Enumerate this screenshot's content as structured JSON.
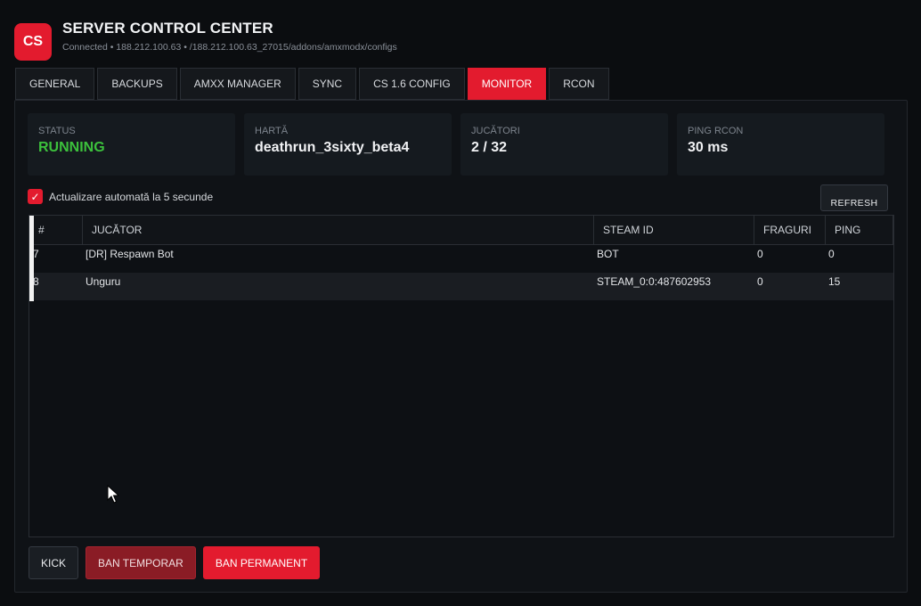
{
  "header": {
    "logo": "CS",
    "title": "SERVER CONTROL CENTER",
    "subtitle": "Connected • 188.212.100.63 • /188.212.100.63_27015/addons/amxmodx/configs"
  },
  "tabs": [
    "GENERAL",
    "BACKUPS",
    "AMXX MANAGER",
    "SYNC",
    "CS 1.6 CONFIG",
    "MONITOR",
    "RCON"
  ],
  "active_tab": "MONITOR",
  "stats": {
    "status": {
      "label": "STATUS",
      "value": "RUNNING"
    },
    "map": {
      "label": "HARTĂ",
      "value": "deathrun_3sixty_beta4"
    },
    "players": {
      "label": "JUCĂTORI",
      "value": "2 / 32"
    },
    "ping": {
      "label": "PING RCON",
      "value": "30 ms"
    }
  },
  "auto_refresh": {
    "checked": true,
    "label": "Actualizare automată la 5 secunde"
  },
  "refresh_button": "REFRESH",
  "table": {
    "columns": [
      "#",
      "JUCĂTOR",
      "STEAM ID",
      "FRAGURI",
      "PING"
    ],
    "rows": [
      [
        "7",
        "[DR] Respawn Bot",
        "BOT",
        "0",
        "0"
      ],
      [
        "8",
        "Unguru",
        "STEAM_0:0:487602953",
        "0",
        "15"
      ]
    ]
  },
  "actions": {
    "kick": "KICK",
    "ban_temp": "BAN TEMPORAR",
    "ban_perm": "BAN PERMANENT"
  },
  "colors": {
    "accent": "#e31b2e",
    "status_running": "#3cc13c",
    "background": "#0b0d10"
  }
}
